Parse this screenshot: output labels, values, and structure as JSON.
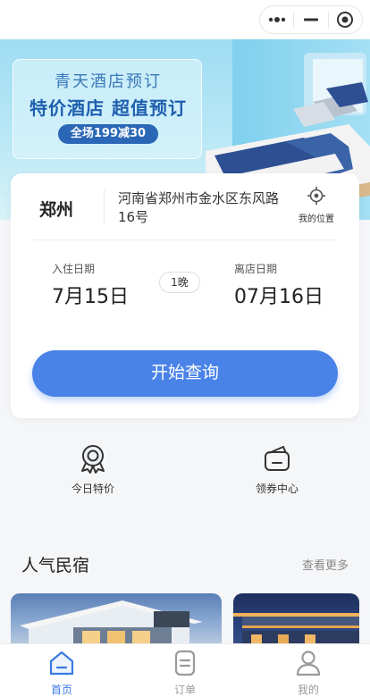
{
  "banner": {
    "line1": "青天酒店预订",
    "line2": "特价酒店 超值预订",
    "badge": "全场199减30"
  },
  "search": {
    "city": "郑州",
    "address": "河南省郑州市金水区东风路16号",
    "location_label": "我的位置",
    "checkin_label": "入住日期",
    "checkin_value": "7月15日",
    "nights": "1晚",
    "checkout_label": "离店日期",
    "checkout_value": "07月16日",
    "button_label": "开始查询"
  },
  "quick": [
    {
      "label": "今日特价",
      "icon": "badge-icon"
    },
    {
      "label": "领券中心",
      "icon": "coupon-wallet-icon"
    }
  ],
  "section": {
    "title": "人气民宿",
    "more": "查看更多"
  },
  "tabs": [
    {
      "label": "首页",
      "icon": "home-icon",
      "active": true
    },
    {
      "label": "订单",
      "icon": "order-icon",
      "active": false
    },
    {
      "label": "我的",
      "icon": "user-icon",
      "active": false
    }
  ],
  "colors": {
    "accent": "#4a83e8",
    "tab_active": "#3a7ae0",
    "tab_inactive": "#9a9a9a"
  }
}
